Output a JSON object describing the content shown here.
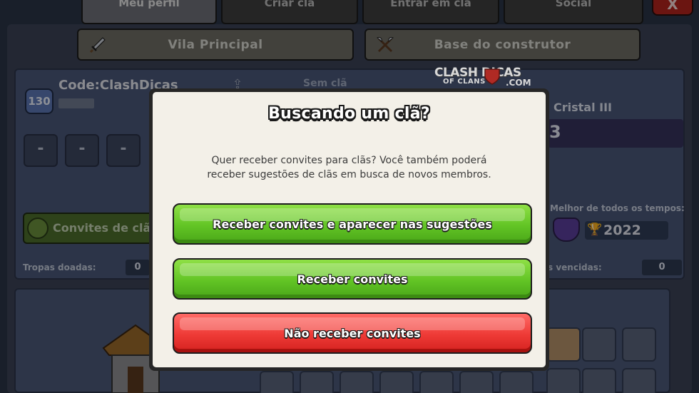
{
  "tabs": [
    {
      "label": "Meu perfil",
      "active": true
    },
    {
      "label": "Criar clã",
      "active": false
    },
    {
      "label": "Entrar em clã",
      "active": false
    },
    {
      "label": "Social",
      "active": false
    }
  ],
  "close_label": "X",
  "villages": {
    "main_label": "Vila Principal",
    "builder_label": "Base do construtor"
  },
  "profile": {
    "level": "130",
    "name": "Code:ClashDicas",
    "clan_status": "Sem clã",
    "slots": [
      "-",
      "-",
      "-"
    ],
    "invites_button": "Convites de clã",
    "league": "Cristal III",
    "trophies": "3",
    "best_label": "Melhor de todos os tempos:",
    "best_value": "2022",
    "donated_label": "Tropas doadas:",
    "donated_value": "0",
    "wins_label": "s vencidas:",
    "wins_value": "0"
  },
  "logo": {
    "line1": "CLASH  DICAS",
    "line2": "OF CLANS",
    "line3": ".COM"
  },
  "modal": {
    "title": "Buscando um clã?",
    "text_line1": "Quer receber convites para clãs? Você também poderá",
    "text_line2": "receber sugestões de clãs em busca de novos membros.",
    "btn_invites_suggestions": "Receber convites e aparecer nas sugestões",
    "btn_invites": "Receber convites",
    "btn_no_invites": "Não receber convites"
  },
  "colors": {
    "green_button": "#62c425",
    "red_button": "#ee3a36",
    "modal_bg": "#f3f0e8"
  }
}
